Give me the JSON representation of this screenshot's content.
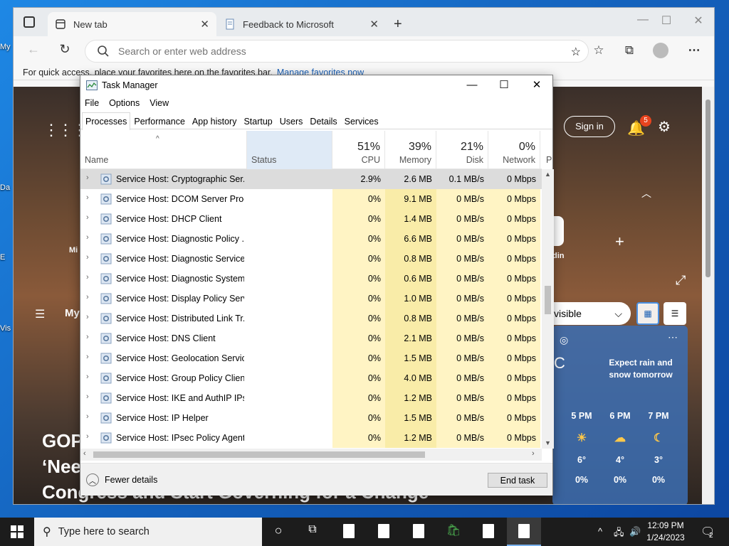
{
  "desktop": {
    "icon_labels": [
      "My",
      "Da",
      "E",
      "Vis"
    ]
  },
  "browser": {
    "tabs": [
      {
        "label": "New tab",
        "active": true
      },
      {
        "label": "Feedback to Microsoft",
        "active": false
      }
    ],
    "address_placeholder": "Search or enter web address",
    "favbar_text": "For quick access, place your favorites here on the favorites bar.",
    "favbar_link": "Manage favorites now",
    "page": {
      "signin": "Sign in",
      "notif_count": "5",
      "label_mi": "Mi",
      "label_my": "My",
      "label_din": "din",
      "visible_text": "visible",
      "weather_text": "Expect rain and snow tomorrow",
      "weather_unit": "C",
      "forecast": [
        {
          "time": "5 PM",
          "temp": "6°",
          "rain": "0%",
          "icon": "partly-cloudy-icon"
        },
        {
          "time": "6 PM",
          "temp": "4°",
          "rain": "0%",
          "icon": "cloudy-moon-icon"
        },
        {
          "time": "7 PM",
          "temp": "3°",
          "rain": "0%",
          "icon": "moon-icon"
        }
      ],
      "headline_lines": [
        "GOP",
        "‘Nee",
        "Congress and Start Governing for a Change"
      ]
    }
  },
  "taskmanager": {
    "title": "Task Manager",
    "menu": [
      "File",
      "Options",
      "View"
    ],
    "tabs": [
      "Processes",
      "Performance",
      "App history",
      "Startup",
      "Users",
      "Details",
      "Services"
    ],
    "selected_tab": "Processes",
    "columns": {
      "name": "Name",
      "status": "Status",
      "cpu_pct": "51%",
      "cpu": "CPU",
      "mem_pct": "39%",
      "mem": "Memory",
      "disk_pct": "21%",
      "disk": "Disk",
      "net_pct": "0%",
      "net": "Network",
      "power_trunc": "P"
    },
    "rows": [
      {
        "name": "Service Host: Cryptographic Ser...",
        "cpu": "2.9%",
        "mem": "2.6 MB",
        "disk": "0.1 MB/s",
        "net": "0 Mbps",
        "selected": true
      },
      {
        "name": "Service Host: DCOM Server Proc...",
        "cpu": "0%",
        "mem": "9.1 MB",
        "disk": "0 MB/s",
        "net": "0 Mbps"
      },
      {
        "name": "Service Host: DHCP Client",
        "cpu": "0%",
        "mem": "1.4 MB",
        "disk": "0 MB/s",
        "net": "0 Mbps"
      },
      {
        "name": "Service Host: Diagnostic Policy ...",
        "cpu": "0%",
        "mem": "6.6 MB",
        "disk": "0 MB/s",
        "net": "0 Mbps"
      },
      {
        "name": "Service Host: Diagnostic Service...",
        "cpu": "0%",
        "mem": "0.8 MB",
        "disk": "0 MB/s",
        "net": "0 Mbps"
      },
      {
        "name": "Service Host: Diagnostic System...",
        "cpu": "0%",
        "mem": "0.6 MB",
        "disk": "0 MB/s",
        "net": "0 Mbps"
      },
      {
        "name": "Service Host: Display Policy Serv...",
        "cpu": "0%",
        "mem": "1.0 MB",
        "disk": "0 MB/s",
        "net": "0 Mbps"
      },
      {
        "name": "Service Host: Distributed Link Tr...",
        "cpu": "0%",
        "mem": "0.8 MB",
        "disk": "0 MB/s",
        "net": "0 Mbps"
      },
      {
        "name": "Service Host: DNS Client",
        "cpu": "0%",
        "mem": "2.1 MB",
        "disk": "0 MB/s",
        "net": "0 Mbps"
      },
      {
        "name": "Service Host: Geolocation Service",
        "cpu": "0%",
        "mem": "1.5 MB",
        "disk": "0 MB/s",
        "net": "0 Mbps"
      },
      {
        "name": "Service Host: Group Policy Client",
        "cpu": "0%",
        "mem": "4.0 MB",
        "disk": "0 MB/s",
        "net": "0 Mbps"
      },
      {
        "name": "Service Host: IKE and AuthIP IPs...",
        "cpu": "0%",
        "mem": "1.2 MB",
        "disk": "0 MB/s",
        "net": "0 Mbps"
      },
      {
        "name": "Service Host: IP Helper",
        "cpu": "0%",
        "mem": "1.5 MB",
        "disk": "0 MB/s",
        "net": "0 Mbps"
      },
      {
        "name": "Service Host: IPsec Policy Agent",
        "cpu": "0%",
        "mem": "1.2 MB",
        "disk": "0 MB/s",
        "net": "0 Mbps"
      }
    ],
    "fewer_details": "Fewer details",
    "end_task": "End task"
  },
  "taskbar": {
    "search_placeholder": "Type here to search",
    "time": "12:09 PM",
    "date": "1/24/2023",
    "notification_count": "2"
  },
  "colors": {
    "cpu_bg": "#fff4c4",
    "mem_bg": "#f9eca8",
    "selected_row": "#dcdcdc",
    "accent": "#0078d4"
  }
}
